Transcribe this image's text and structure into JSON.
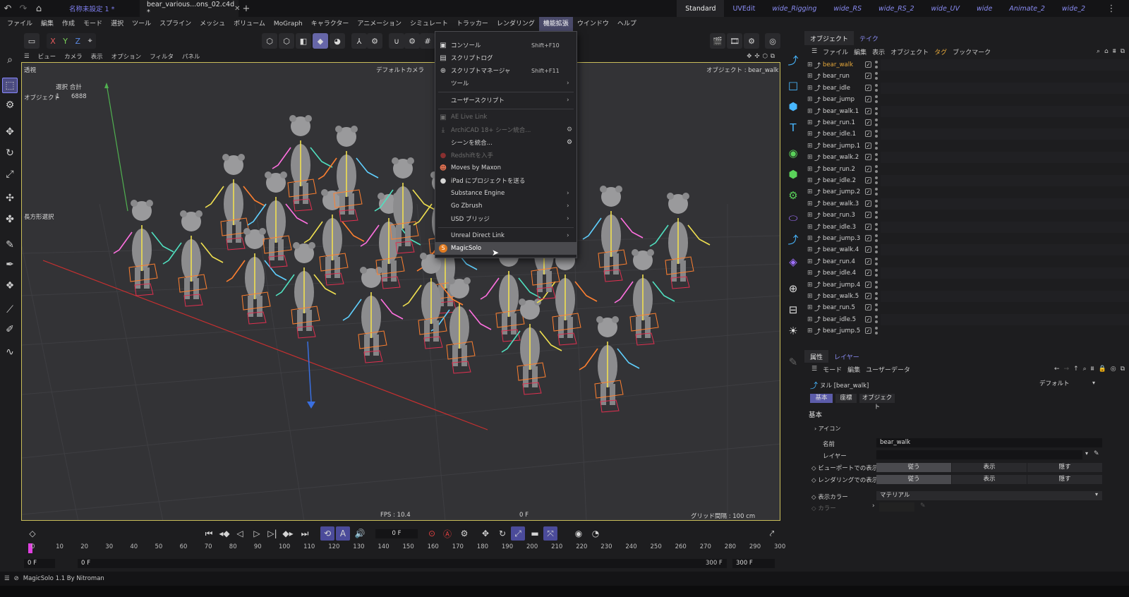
{
  "titlebar": {
    "doc_tabs": [
      "名称未設定 1 *",
      "bear_various...ons_02.c4d *"
    ],
    "layouts": [
      "Standard",
      "UVEdit",
      "wide_Rigging",
      "wide_RS",
      "wide_RS_2",
      "wide_UV",
      "wide",
      "Animate_2",
      "wide_2"
    ]
  },
  "menubar": [
    "ファイル",
    "編集",
    "作成",
    "モード",
    "選択",
    "ツール",
    "スプライン",
    "メッシュ",
    "ボリューム",
    "MoGraph",
    "キャラクター",
    "アニメーション",
    "シミュレート",
    "トラッカー",
    "レンダリング",
    "機能拡張",
    "ウインドウ",
    "ヘルプ"
  ],
  "toolbar_axes": [
    "X",
    "Y",
    "Z"
  ],
  "viewport": {
    "menu": [
      "ビュー",
      "カメラ",
      "表示",
      "オプション",
      "フィルタ",
      "パネル"
    ],
    "view_name": "透視",
    "camera": "デフォルトカメラ",
    "object_label": "オブジェクト : bear_walk",
    "stats_header": "選択  合計",
    "stats_row_label": "オブジェクト",
    "stats_selected": "1",
    "stats_total": "6888",
    "rect_select": "長方形選択",
    "fps": "FPS : 10.4",
    "frame": "0 F",
    "grid": "グリッド間隔 : 100 cm"
  },
  "dropdown": {
    "items": [
      {
        "label": "コンソール",
        "shortcut": "Shift+F10",
        "icon": "console-icon"
      },
      {
        "label": "スクリプトログ",
        "icon": "script-log-icon"
      },
      {
        "label": "スクリプトマネージャ",
        "shortcut": "Shift+F11",
        "icon": "script-manager-icon"
      },
      {
        "label": "ツール",
        "arrow": "›"
      },
      {
        "label": "ユーザースクリプト",
        "arrow": "›"
      },
      {
        "label": "AE Live Link",
        "disabled": true
      },
      {
        "label": "ArchiCAD 18+ シーン統合...",
        "disabled": true
      },
      {
        "label": "シーンを統合..."
      },
      {
        "label": "Redshiftを入手",
        "disabled": true
      },
      {
        "label": "Moves by Maxon"
      },
      {
        "label": "iPad にプロジェクトを送る"
      },
      {
        "label": "Substance Engine",
        "arrow": "›"
      },
      {
        "label": "Go Zbrush",
        "arrow": "›"
      },
      {
        "label": "USD ブリッジ",
        "arrow": "›"
      },
      {
        "label": "Unreal Direct Link",
        "arrow": "›"
      },
      {
        "label": "MagicSolo"
      }
    ]
  },
  "objects": {
    "tabs": [
      "オブジェクト",
      "テイク"
    ],
    "menu": [
      "ファイル",
      "編集",
      "表示",
      "オブジェクト",
      "タグ",
      "ブックマーク"
    ],
    "items": [
      "bear_walk",
      "bear_run",
      "bear_idle",
      "bear_jump",
      "bear_walk.1",
      "bear_run.1",
      "bear_idle.1",
      "bear_jump.1",
      "bear_walk.2",
      "bear_run.2",
      "bear_idle.2",
      "bear_jump.2",
      "bear_walk.3",
      "bear_run.3",
      "bear_idle.3",
      "bear_jump.3",
      "bear_walk.4",
      "bear_run.4",
      "bear_idle.4",
      "bear_jump.4",
      "bear_walk.5",
      "bear_run.5",
      "bear_idle.5",
      "bear_jump.5"
    ]
  },
  "attributes": {
    "tabs": [
      "属性",
      "レイヤー"
    ],
    "menu": [
      "モード",
      "編集",
      "ユーザーデータ"
    ],
    "object_title": "ヌル [bear_walk]",
    "preset": "デフォルト",
    "subtabs": [
      "基本",
      "座標",
      "オブジェクト"
    ],
    "section": "基本",
    "icon_group": "アイコン",
    "name_label": "名前",
    "name_value": "bear_walk",
    "layer_label": "レイヤー",
    "viewport_vis_label": "ビューポートでの表示",
    "render_vis_label": "レンダリングでの表示",
    "vis_options": [
      "従う",
      "表示",
      "隠す"
    ],
    "display_color_label": "表示カラー",
    "display_color_value": "マテリアル",
    "color_label": "カラー"
  },
  "timeline": {
    "current_frame": "0 F",
    "ticks": [
      "0",
      "10",
      "20",
      "30",
      "40",
      "50",
      "60",
      "70",
      "80",
      "90",
      "100",
      "110",
      "120",
      "130",
      "140",
      "150",
      "160",
      "170",
      "180",
      "190",
      "200",
      "210",
      "220",
      "230",
      "240",
      "250",
      "260",
      "270",
      "280",
      "290",
      "300"
    ],
    "start1": "0 F",
    "start2": "0 F",
    "end1": "300 F",
    "end2": "300 F"
  },
  "status": "MagicSolo 1.1 By Nitroman",
  "colors": {
    "accent": "#6666a8",
    "selected_object": "#e6a83a",
    "viewport_border": "#c9bd5a"
  }
}
